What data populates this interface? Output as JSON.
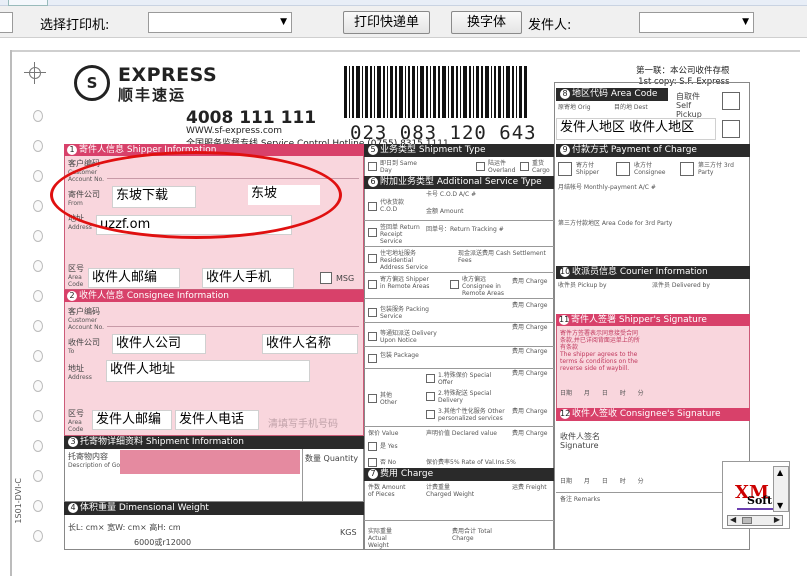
{
  "toolbar": {
    "printer_label": "选择打印机:",
    "printer_value": "",
    "print_button": "打印快递单",
    "font_button": "换字体",
    "sender_label": "发件人:",
    "sender_value": ""
  },
  "waybill": {
    "logo_letter": "S",
    "logo_text_en": "EXPRESS",
    "logo_text_cn": "顺丰速运",
    "hotline": "4008 111 111",
    "website": "WWW.sf-express.com",
    "service_hotline": "全国服务监督专线  Service Control Hotline  (0755) 8315 1111",
    "barcode_number": "023 083 120 643",
    "copy_label_cn": "第一联：本公司收件存根",
    "copy_label_en": "1st copy: S.F. Express",
    "sections": {
      "shipper": "寄件人信息 Shipper Information",
      "consignee": "收件人信息 Consignee Information",
      "shipment": "托寄物详细资料 Shipment Information",
      "dimension": "体积重量 Dimensional Weight",
      "service_type": "业务类型 Shipment Type",
      "additional": "附加业务类型 Additional Service Type",
      "charge": "费用 Charge",
      "area_code": "地区代码 Area Code",
      "payment": "付款方式 Payment of Charge",
      "courier": "收派员信息 Courier Information",
      "shipper_sig": "寄件人签署 Shipper's Signature",
      "consignee_sig": "收件人签收 Consignee's Signature"
    },
    "labels": {
      "customer_no": "客户编码",
      "customer_no_en": "Customer Account No.",
      "company": "寄件公司",
      "company_en": "From",
      "address": "地址",
      "address_en": "Address",
      "area": "区号",
      "area_en": "Area Code",
      "msg": "MSG",
      "to": "收件公司",
      "to_en": "To",
      "contents": "托寄物内容",
      "contents_en": "Description of Goods",
      "quantity": "数量 Quantity",
      "origin": "原寄地 Orig",
      "dest": "目的地 Dest",
      "self_pickup": "自取件 Self Pickup",
      "payment_shipper": "寄方付 Shipper",
      "payment_consignee": "收方付 Consignee",
      "payment_3rd": "第三方付 3rd Party",
      "monthly": "月结帐号 Monthly-payment A/C #",
      "third_area": "第三方付款地区 Area Code for 3rd Party",
      "pickup_by": "收件员 Pickup by",
      "delivered_by": "派件员 Delivered by",
      "date": "日期 Date",
      "recipient_sig": "收件人签名 Signature",
      "remarks": "备注 Remarks",
      "pieces": "件数 Amount of Pieces",
      "charged_weight": "计费重量 Charged Weight",
      "freight": "运费 Freight",
      "actual_weight": "实际重量 Actual Weight",
      "total": "费用合计 Total Charge",
      "dims": "长L:    cm× 宽W:    cm× 高H:    cm",
      "dims_div": "6000或r12000",
      "kgs": "KGS",
      "insured_value": "保价 Value",
      "insured_yes": "是 Yes",
      "insured_no": "否 No",
      "declared": "声明价值 Declared value",
      "rate": "保价费率5%  Rate of Val.Ins.5%",
      "cod": "代收货款 C.O.D",
      "cod_no": "卡号 C.O.D A/C #",
      "cod_amount": "金额 Amount",
      "return_receipt": "签回单 Return Receipt Service",
      "return_no": "回单号：Return Tracking #",
      "residential": "住宅地址服务 Residential Address Service",
      "cash_fee": "现金派送费用 Cash Settlement Fees",
      "remote_ship": "寄方偏远 Shipper in Remote Areas",
      "remote_cons": "收方偏远 Consignee in Remote Areas",
      "packing": "包装服务 Packing Service",
      "delivery_notice": "等通知派送 Delivery Upon Notice",
      "package": "包装 Package",
      "special_offer": "1.特殊保价 Special Offer",
      "special_delivery": "2.特殊配送 Special Delivery",
      "personalized": "3.其他个性化服务 Other personalized services",
      "other": "其他 Other",
      "charge": "费用 Charge",
      "same_day": "即日到 Same Day",
      "overland": "陆运件 Overland",
      "cargo": "重货 Cargo",
      "shipper_terms": "寄件方签署表示同意接受合同条款,并已详阅背面运单上的所有条款\nThe shipper agrees to the terms & conditions on the reverse side of waybill.",
      "date_row": "日期  月  日  时  分"
    },
    "fields": {
      "sender_company": "东坡下载",
      "sender_name": "东坡",
      "sender_address": "uzzf.om",
      "recipient_zip": "收件人邮编",
      "recipient_phone": "收件人手机",
      "recipient_company": "收件人公司",
      "recipient_name": "收件人名称",
      "recipient_address": "收件人地址",
      "sender_zip": "发件人邮编",
      "sender_phone": "发件人电话",
      "area_code_value": "发件人地区 收件人地区"
    },
    "watermark": "清填写手机号码"
  },
  "side_code": "1S01-DVI-C",
  "badge": {
    "xm": "XM",
    "soft": "Soft"
  },
  "colors": {
    "pink_head": "#d8416a",
    "pink_bg": "#f9d6dd",
    "ellipse": "#e01010"
  }
}
